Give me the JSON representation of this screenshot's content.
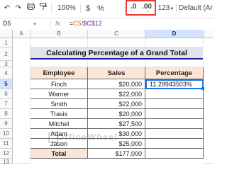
{
  "toolbar": {
    "zoom": "100%",
    "currency": "$",
    "percent": "%",
    "decrease_decimal": ".0",
    "increase_decimal": ".00",
    "more_formats": "123",
    "font": "Default (Ari..."
  },
  "formula_bar": {
    "cell_ref": "D5",
    "fx": "fx",
    "formula_prefix": "=",
    "formula_ref1": "C5",
    "formula_rest": "/$C$12"
  },
  "columns": [
    "A",
    "B",
    "C",
    "D"
  ],
  "rows": [
    "1",
    "2",
    "3",
    "4",
    "5",
    "6",
    "7",
    "8",
    "9",
    "10",
    "11",
    "12",
    "13"
  ],
  "sheet": {
    "title": "Calculating Percentage of a Grand Total",
    "headers": [
      "Employee",
      "Sales",
      "Percentage"
    ],
    "rows": [
      {
        "employee": "Finch",
        "sales": "$20,000",
        "percentage": "11.29943503%"
      },
      {
        "employee": "Warner",
        "sales": "$22,000",
        "percentage": ""
      },
      {
        "employee": "Smith",
        "sales": "$22,000",
        "percentage": ""
      },
      {
        "employee": "Travis",
        "sales": "$20,000",
        "percentage": ""
      },
      {
        "employee": "Mitchel",
        "sales": "$27,500",
        "percentage": ""
      },
      {
        "employee": "Adam",
        "sales": "$30,000",
        "percentage": ""
      },
      {
        "employee": "Jason",
        "sales": "$25,000",
        "percentage": ""
      }
    ],
    "total_label": "Total",
    "total_value": "$177,000"
  },
  "watermark": {
    "name": "OfficeWheel"
  }
}
